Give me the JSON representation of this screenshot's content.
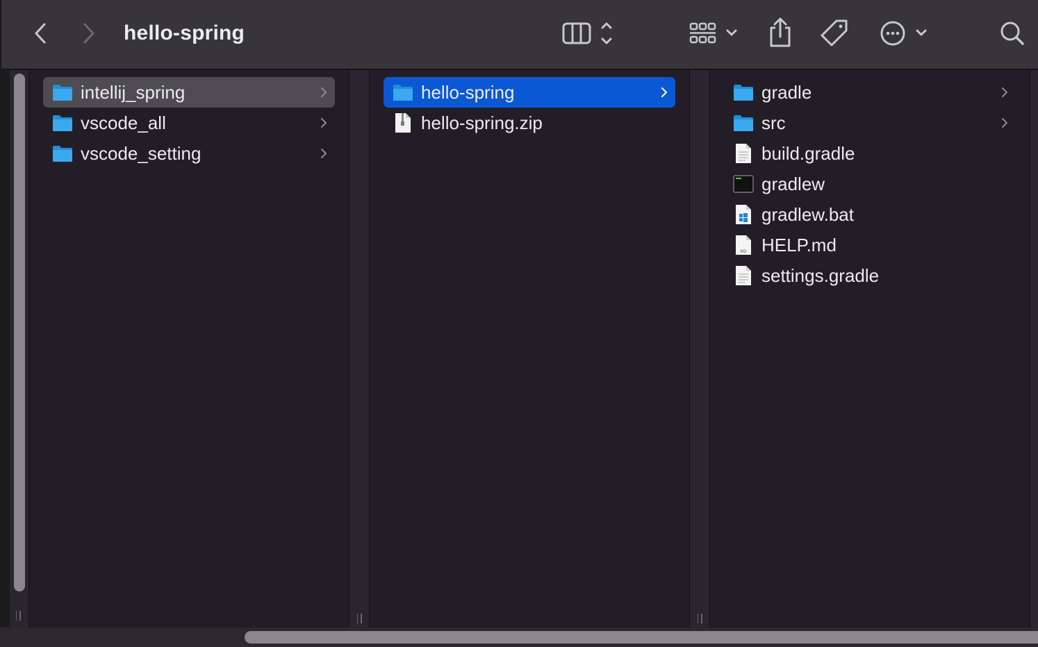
{
  "window": {
    "title": "hello-spring"
  },
  "toolbar": {
    "back_icon": "chevron-left-icon",
    "forward_icon": "chevron-right-icon",
    "view_icon": "column-view-icon",
    "group_icon": "group-grid-icon",
    "share_icon": "share-icon",
    "tag_icon": "tag-icon",
    "more_icon": "ellipsis-circle-icon",
    "search_icon": "search-icon"
  },
  "columns": [
    {
      "items": [
        {
          "label": "intellij_spring",
          "type": "folder",
          "selected": "inactive",
          "has_children": true
        },
        {
          "label": "vscode_all",
          "type": "folder",
          "selected": "none",
          "has_children": true
        },
        {
          "label": "vscode_setting",
          "type": "folder",
          "selected": "none",
          "has_children": true
        }
      ]
    },
    {
      "items": [
        {
          "label": "hello-spring",
          "type": "folder",
          "selected": "active",
          "has_children": true
        },
        {
          "label": "hello-spring.zip",
          "type": "zip",
          "selected": "none",
          "has_children": false
        }
      ]
    },
    {
      "items": [
        {
          "label": "gradle",
          "type": "folder",
          "selected": "none",
          "has_children": true
        },
        {
          "label": "src",
          "type": "folder",
          "selected": "none",
          "has_children": true
        },
        {
          "label": "build.gradle",
          "type": "document",
          "selected": "none",
          "has_children": false
        },
        {
          "label": "gradlew",
          "type": "executable",
          "selected": "none",
          "has_children": false
        },
        {
          "label": "gradlew.bat",
          "type": "bat",
          "selected": "none",
          "has_children": false
        },
        {
          "label": "HELP.md",
          "type": "markdown",
          "selected": "none",
          "has_children": false
        },
        {
          "label": "settings.gradle",
          "type": "document",
          "selected": "none",
          "has_children": false
        }
      ]
    }
  ],
  "file_icons": {
    "md_badge": "MD"
  },
  "colors": {
    "selection_active": "#0b58d4",
    "selection_inactive": "#4e4b52",
    "folder": "#3aa9ef",
    "background": "#221d27",
    "toolbar": "#37353a"
  }
}
